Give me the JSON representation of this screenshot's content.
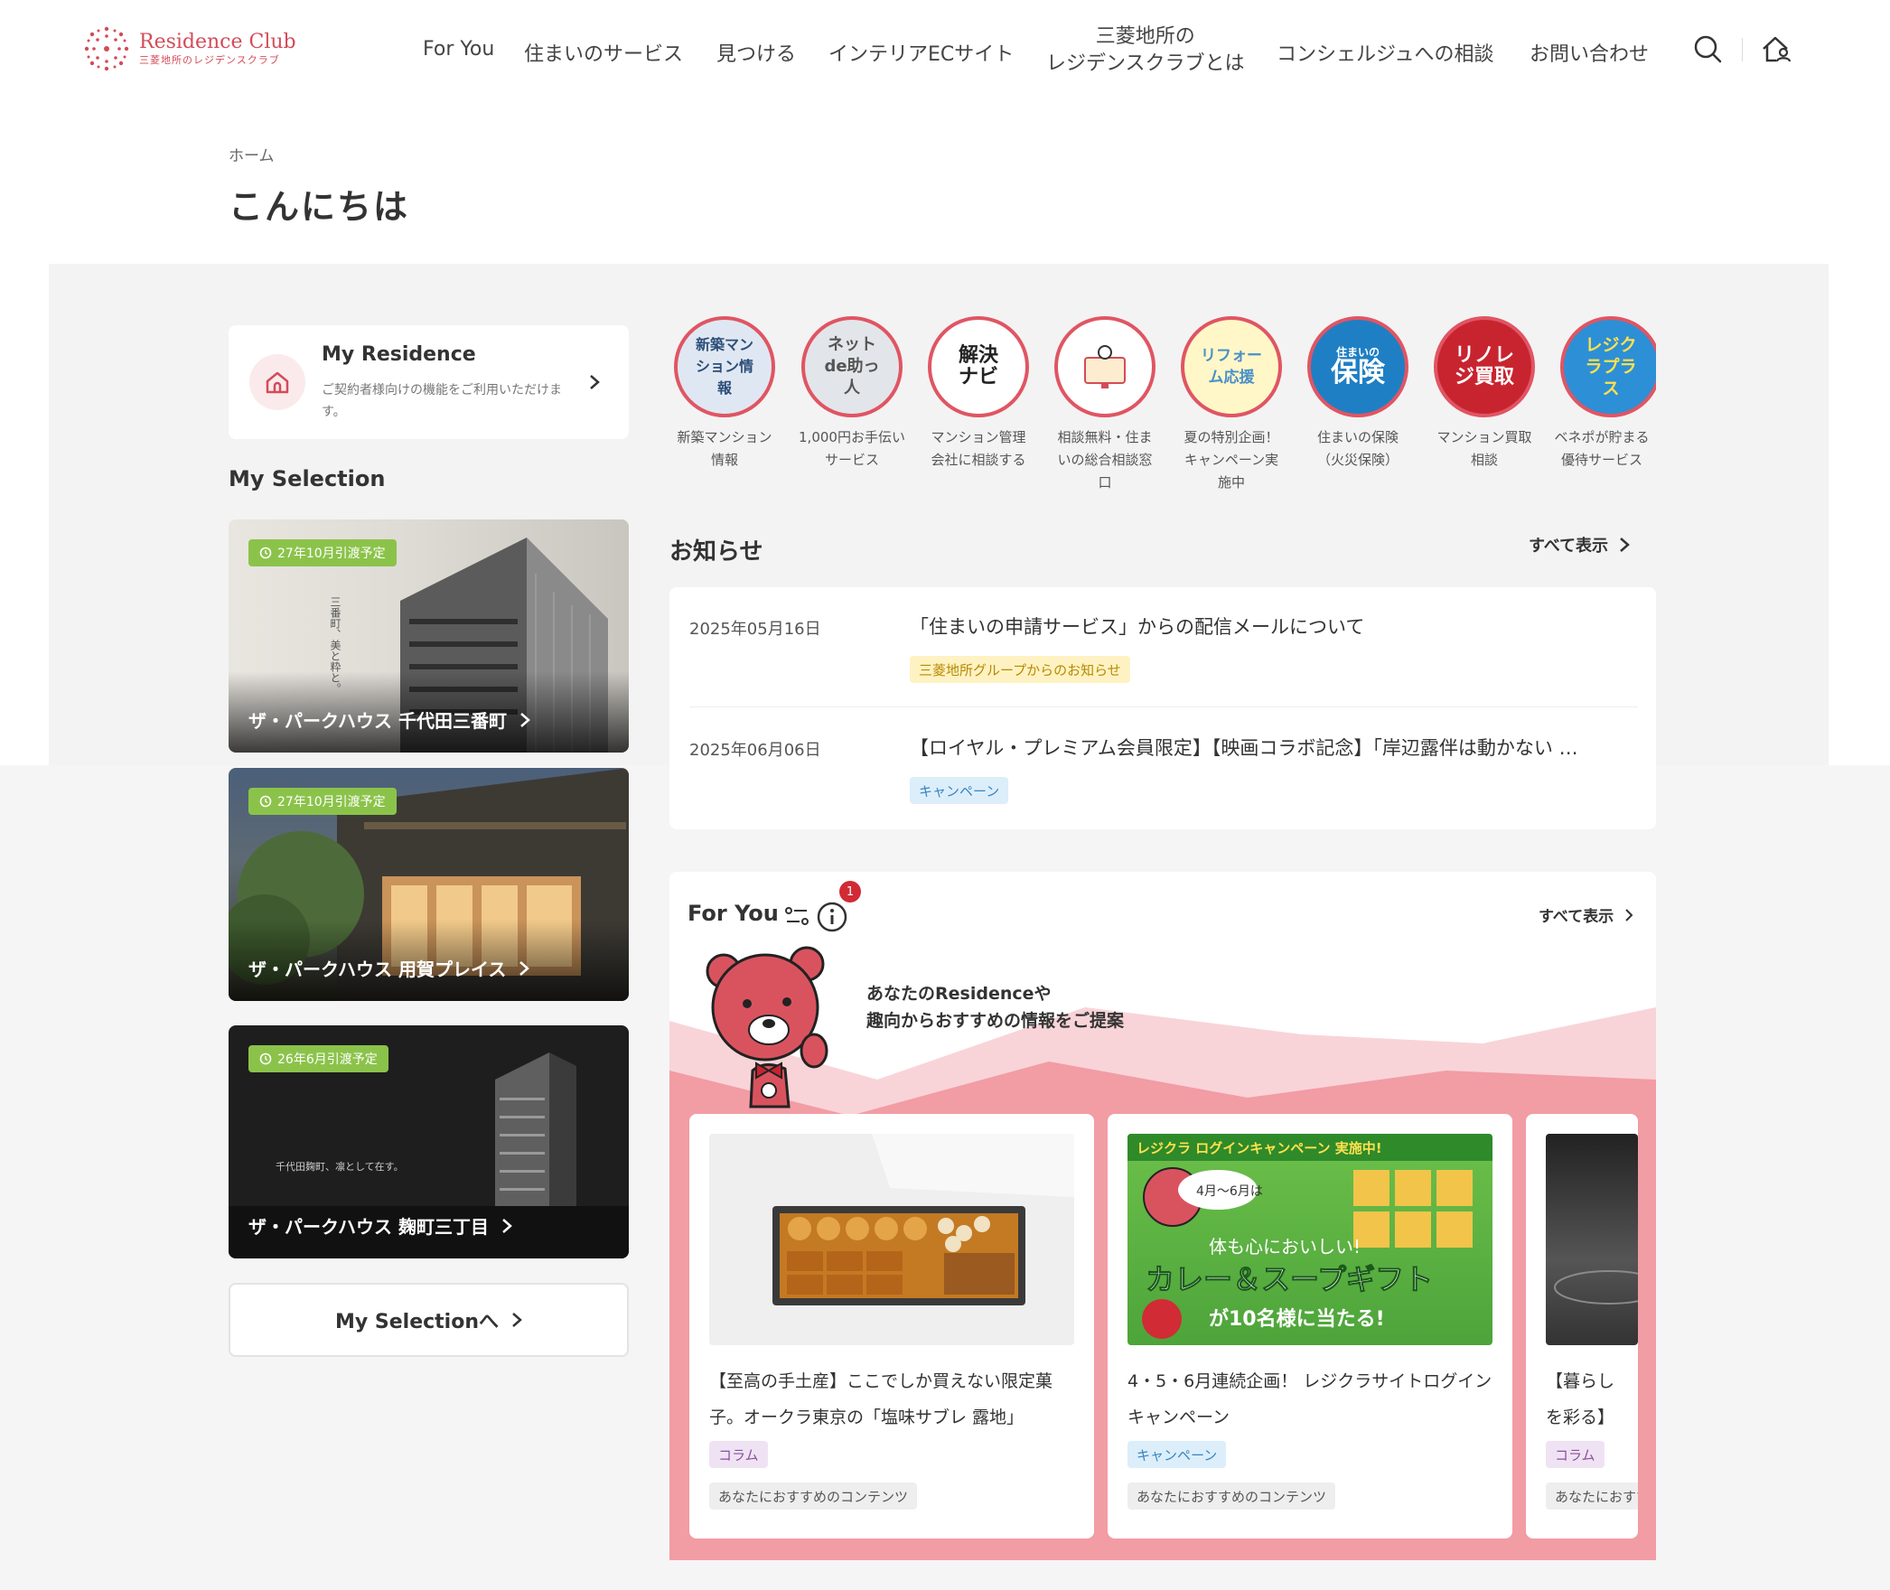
{
  "header": {
    "logo_title": "Residence Club",
    "logo_sub": "三菱地所のレジデンスクラブ",
    "nav": [
      {
        "label": "For You"
      },
      {
        "label": "住まいのサービス"
      },
      {
        "label": "見つける"
      },
      {
        "label": "インテリアECサイト"
      },
      {
        "label_line1": "三菱地所の",
        "label_line2": "レジデンスクラブとは"
      },
      {
        "label": "コンシェルジュへの相談"
      },
      {
        "label": "お問い合わせ"
      }
    ]
  },
  "breadcrumb": "ホーム",
  "page_title": "こんにちは",
  "residence": {
    "title": "My Residence",
    "desc": "ご契約者様向けの機能をご利用いただけます。"
  },
  "selection": {
    "title": "My Selection",
    "cards": [
      {
        "badge": "27年10月引渡予定",
        "name": "ザ・パークハウス 千代田三番町",
        "overlay": "三番町、美と粋と。"
      },
      {
        "badge": "27年10月引渡予定",
        "name": "ザ・パークハウス 用賀プレイス"
      },
      {
        "badge": "26年6月引渡予定",
        "name": "ザ・パークハウス 麹町三丁目",
        "overlay": "千代田麹町、凛として在す。"
      }
    ],
    "button_label": "My Selectionへ"
  },
  "services": [
    {
      "icon_text": "新築マンション情報",
      "label_line1": "新築マンション",
      "label_line2": "情報"
    },
    {
      "icon_text": "ネットde助っ人",
      "label_line1": "1,000円お手伝い",
      "label_line2": "サービス"
    },
    {
      "icon_text": "解決ナビ",
      "label_line1": "マンション管理",
      "label_line2": "会社に相談する"
    },
    {
      "icon_text": "相談",
      "label_line1": "相談無料・住ま",
      "label_line2": "いの総合相談窓",
      "label_line3": "口"
    },
    {
      "icon_text": "リフォーム応援",
      "label_line1": "夏の特別企画！",
      "label_line2": "キャンペーン実",
      "label_line3": "施中"
    },
    {
      "icon_text_small": "住まいの",
      "icon_text": "保険",
      "label_line1": "住まいの保険",
      "label_line2": "（火災保険）"
    },
    {
      "icon_text": "リノレジ買取",
      "label_line1": "マンション買取",
      "label_line2": "相談"
    },
    {
      "icon_text": "レジクラプラス",
      "label_line1": "ベネポが貯まる",
      "label_line2": "優待サービス"
    }
  ],
  "notices": {
    "title": "お知らせ",
    "see_all": "すべて表示",
    "items": [
      {
        "date": "2025年05月16日",
        "text": "「住まいの申請サービス」からの配信メールについて",
        "tag": "三菱地所グループからのお知らせ"
      },
      {
        "date": "2025年06月06日",
        "text": "【ロイヤル・プレミアム会員限定】【映画コラボ記念】「岸辺露伴は動かない …",
        "tag": "キャンペーン"
      }
    ]
  },
  "foryou": {
    "title": "For You",
    "badge": "1",
    "see_all": "すべて表示",
    "message_line1": "あなたのResidenceや",
    "message_line2": "趣向からおすすめの情報をご提案",
    "cards": [
      {
        "title": "【至高の手土産】ここでしか買えない限定菓子。オークラ東京の「塩味サブレ 露地」",
        "tag1": "コラム",
        "tag2": "あなたにおすすめのコンテンツ"
      },
      {
        "title": "4・5・6月連続企画！ レジクラサイトログインキャンペーン",
        "tag1": "キャンペーン",
        "tag2": "あなたにおすすめのコンテンツ",
        "img_banner": "レジクラ ログインキャンペーン 実施中!",
        "img_period": "4月～6月は",
        "img_line1": "体も心においしい!",
        "img_line2": "カレー＆スープギフト",
        "img_line3": "が10名様に当たる!"
      },
      {
        "title": "【暮らしを彩る】緑ガラス器",
        "tag1": "コラム",
        "tag2": "あなたにおすすめのコンテンツ"
      }
    ]
  },
  "colors": {
    "brand": "#d44b58",
    "badge_green": "#8bc34a",
    "pink_bg": "#f29ca4"
  }
}
